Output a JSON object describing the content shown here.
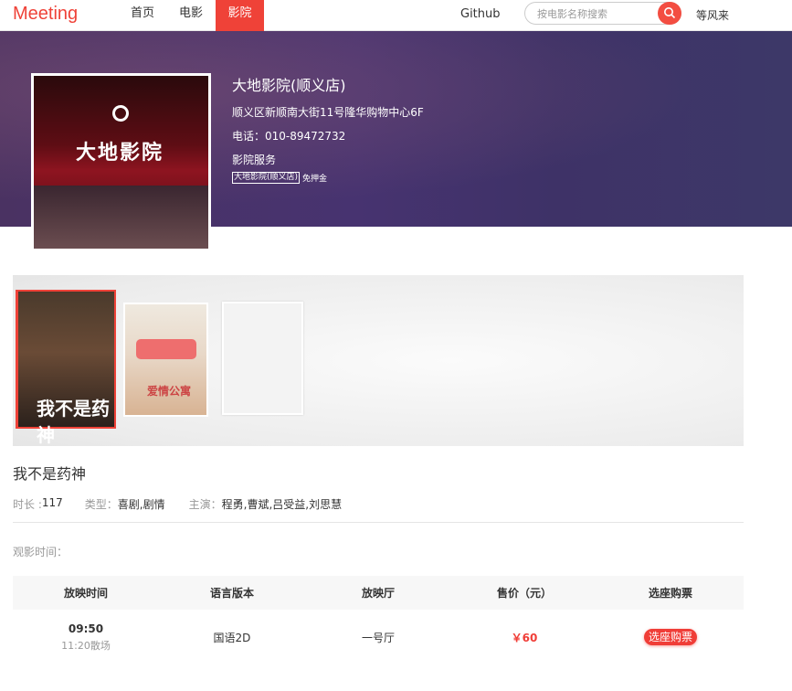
{
  "nav": {
    "logo": "Meeting",
    "items": [
      "首页",
      "电影",
      "影院"
    ],
    "active": "影院",
    "github": "Github",
    "search_placeholder": "按电影名称搜索",
    "user": "等风来"
  },
  "cinema": {
    "name": "大地影院(顺义店)",
    "address": "顺义区新顺南大街11号隆华购物中心6F",
    "phone": "电话：010-89472732",
    "service_label": "影院服务",
    "tags": [
      "大地影院(顺义店)",
      "免押金"
    ],
    "poster_text": "大地影院"
  },
  "carousel": {
    "posters": [
      {
        "title_text": "我不是药神"
      },
      {
        "title_text": "爱情公寓"
      },
      {
        "title_text": ""
      }
    ]
  },
  "movie": {
    "title": "我不是药神",
    "duration_label": "时长 :",
    "duration": "117",
    "genre_label": "类型：",
    "genre": "喜剧,剧情",
    "cast_label": "主演：",
    "cast": "程勇,曹斌,吕受益,刘思慧"
  },
  "showtimes": {
    "label": "观影时间：",
    "headers": [
      "放映时间",
      "语言版本",
      "放映厅",
      "售价（元）",
      "选座购票"
    ],
    "rows": [
      {
        "start": "09:50",
        "end": "11:20散场",
        "language": "国语2D",
        "hall": "一号厅",
        "price": "￥60",
        "buy": "选座购票"
      }
    ]
  },
  "colors": {
    "accent": "#ef4238",
    "banner": "#473370"
  }
}
